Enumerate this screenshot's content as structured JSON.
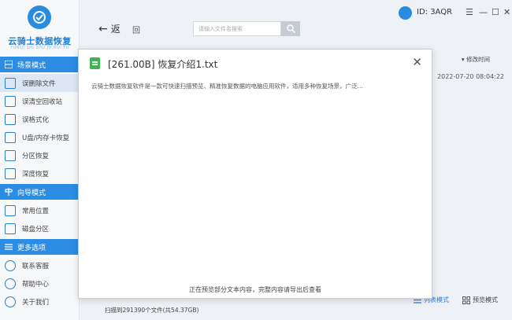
{
  "app": {
    "logo_text": "云骑士数据恢复",
    "logo_sub": "YUNQI SHI SHU JU HUI FU"
  },
  "sidebar": {
    "sections": [
      {
        "label": "场景模式",
        "items": [
          {
            "label": "误删除文件",
            "icon": "trash-icon",
            "active": true
          },
          {
            "label": "误清空回收站",
            "icon": "recycle-bin-icon"
          },
          {
            "label": "误格式化",
            "icon": "format-icon"
          },
          {
            "label": "U盘/内存卡恢复",
            "icon": "usb-icon"
          },
          {
            "label": "分区恢复",
            "icon": "partition-icon"
          },
          {
            "label": "深度恢复",
            "icon": "deep-scan-icon"
          }
        ]
      },
      {
        "label": "向导模式",
        "items": [
          {
            "label": "常用位置",
            "icon": "location-icon"
          },
          {
            "label": "磁盘分区",
            "icon": "disk-icon"
          }
        ]
      },
      {
        "label": "更多选项",
        "items": [
          {
            "label": "联系客服",
            "icon": "headset-icon"
          },
          {
            "label": "帮助中心",
            "icon": "help-icon"
          },
          {
            "label": "关于我们",
            "icon": "info-icon"
          }
        ]
      }
    ]
  },
  "toolbar": {
    "back_label": "返",
    "home_label": "回",
    "search_placeholder": "请输入文件名搜索"
  },
  "user": {
    "id_label": "ID: 3AQR"
  },
  "window_controls": {
    "menu": "☰",
    "minimize": "—",
    "maximize": "☐",
    "close": "✕"
  },
  "list": {
    "column_modified": "修改时间",
    "row_modified": "2022-07-20 08:04:22"
  },
  "status": {
    "scan_text": "扫描到291390个文件(共54.37GB)"
  },
  "view_modes": {
    "list": "列表模式",
    "preview": "预览模式"
  },
  "dialog": {
    "title": "[261.00B] 恢复介绍1.txt",
    "content": "云骑士数据恢复软件是一款可快速扫描预览、精准恢复数据的电脑应用软件，适用多种恢复场景，广泛...",
    "footer": "正在预览部分文本内容，完整内容请导出后查看"
  },
  "colors": {
    "accent": "#2b8de3",
    "file_icon": "#3fb34f"
  }
}
